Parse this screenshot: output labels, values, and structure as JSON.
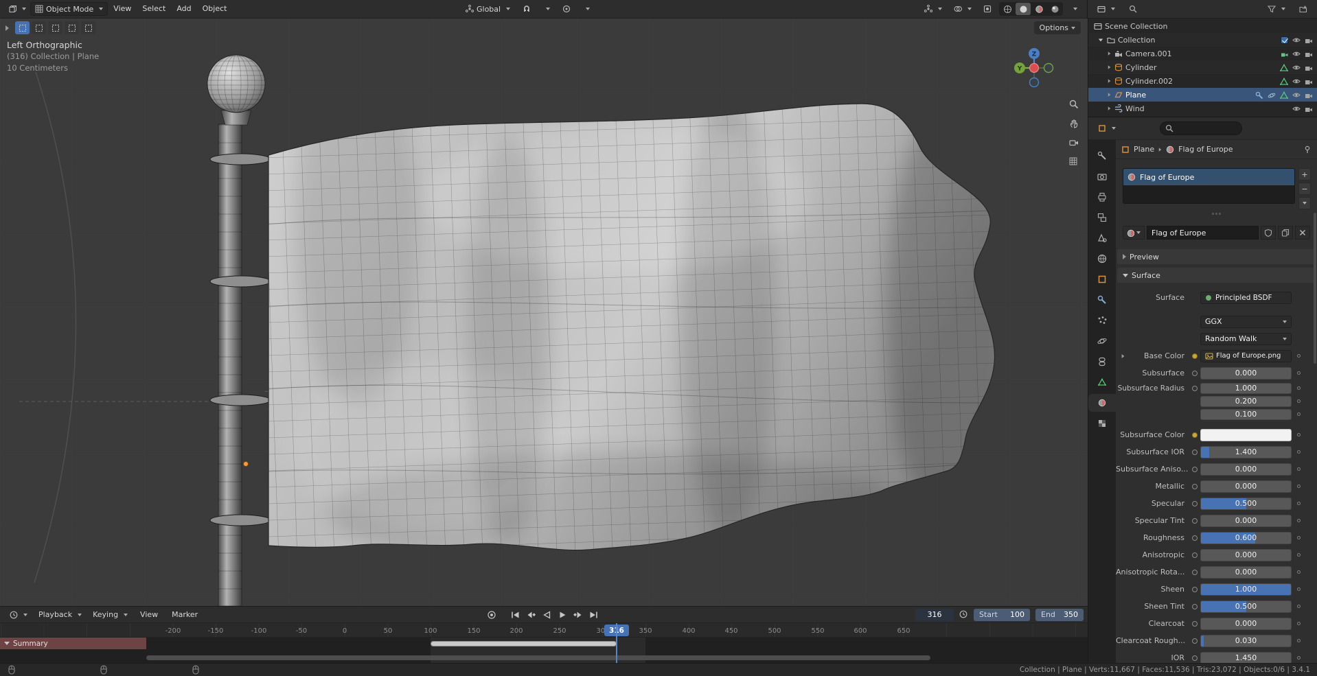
{
  "colors": {
    "accent": "#4772b3",
    "selection": "#39557a",
    "summary_channel": "#6d4343",
    "keyframe_band": "#c9c9c9",
    "subsurface_color_swatch": "#ffffff"
  },
  "icons": {
    "search": "magnifier",
    "filter": "funnel",
    "pin": "pin",
    "fake_user": "shield",
    "duplicate": "copy",
    "unlink": "x",
    "autokey": "record-dot",
    "snap": "magnet",
    "editor_3d": "cube",
    "editor_timeline": "clock"
  },
  "topbar": {
    "mode_label": "Object Mode",
    "menus": [
      "View",
      "Select",
      "Add",
      "Object"
    ],
    "orientation": "Global",
    "options_label": "Options"
  },
  "viewport": {
    "view_name": "Left Orthographic",
    "context_line": "(316) Collection | Plane",
    "grid_scale": "10 Centimeters",
    "gizmo": {
      "z": "Z",
      "y": "Y"
    }
  },
  "outliner": {
    "scene_collection": "Scene Collection",
    "collection": "Collection",
    "items": [
      {
        "label": "Camera.001",
        "icon": "camera-object"
      },
      {
        "label": "Cylinder",
        "icon": "mesh-cylinder"
      },
      {
        "label": "Cylinder.002",
        "icon": "mesh-cylinder"
      },
      {
        "label": "Plane",
        "icon": "mesh-plane",
        "selected": true
      },
      {
        "label": "Wind",
        "icon": "force-field-wind"
      }
    ]
  },
  "properties": {
    "breadcrumb_object": "Plane",
    "breadcrumb_material": "Flag of Europe",
    "slot_name": "Flag of Europe",
    "datablock_name": "Flag of Europe",
    "preview_label": "Preview",
    "surface_section_label": "Surface",
    "surface_row_label": "Surface",
    "surface_shader": "Principled BSDF",
    "distribution": "GGX",
    "subsurface_method": "Random Walk",
    "base_color_label": "Base Color",
    "base_color_value": "Flag of Europe.png",
    "params": [
      {
        "label": "Subsurface",
        "value": "0.000"
      },
      {
        "label": "Subsurface Radius",
        "v1": "1.000",
        "v2": "0.200",
        "v3": "0.100"
      },
      {
        "label": "Subsurface Color",
        "swatch": "#ffffff"
      },
      {
        "label": "Subsurface IOR",
        "value": "1.400"
      },
      {
        "label": "Subsurface Aniso...",
        "value": "0.000"
      },
      {
        "label": "Metallic",
        "value": "0.000"
      },
      {
        "label": "Specular",
        "value": "0.500"
      },
      {
        "label": "Specular Tint",
        "value": "0.000"
      },
      {
        "label": "Roughness",
        "value": "0.600"
      },
      {
        "label": "Anisotropic",
        "value": "0.000"
      },
      {
        "label": "Anisotropic Rota...",
        "value": "0.000"
      },
      {
        "label": "Sheen",
        "value": "1.000"
      },
      {
        "label": "Sheen Tint",
        "value": "0.500"
      },
      {
        "label": "Clearcoat",
        "value": "0.000"
      },
      {
        "label": "Clearcoat Rough...",
        "value": "0.030"
      },
      {
        "label": "IOR",
        "value": "1.450"
      }
    ]
  },
  "timeline": {
    "menus": [
      "Playback",
      "Keying",
      "View",
      "Marker"
    ],
    "frame_value": "316",
    "playhead_label": "316",
    "start_label": "Start",
    "start_value": "100",
    "end_label": "End",
    "end_value": "350",
    "summary_label": "Summary",
    "ticks": [
      "-200",
      "-150",
      "-100",
      "-50",
      "0",
      "50",
      "100",
      "150",
      "200",
      "250",
      "300",
      "350",
      "400",
      "450",
      "500",
      "550",
      "600",
      "650"
    ]
  },
  "statusbar": {
    "text": "Collection | Plane | Verts:11,667 | Faces:11,536 | Tris:23,072 | Objects:0/6 | 3.4.1"
  }
}
